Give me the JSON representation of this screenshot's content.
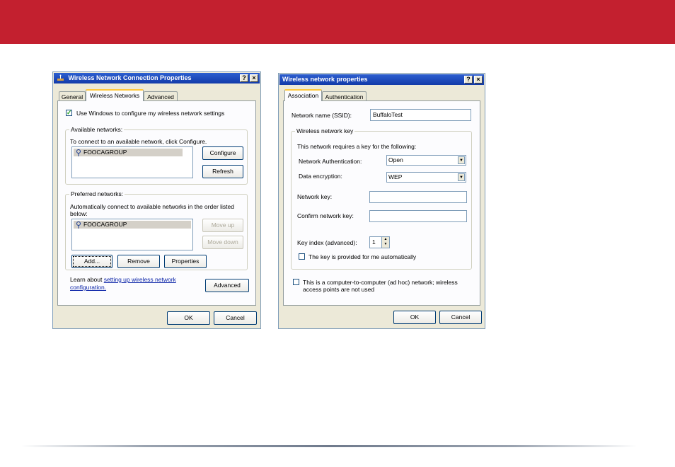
{
  "colors": {
    "banner": "#c3202f",
    "titlebar": "#2d5fd0"
  },
  "left_dialog": {
    "title": "Wireless Network Connection Properties",
    "help_button": "?",
    "close_button": "×",
    "tabs": [
      "General",
      "Wireless Networks",
      "Advanced"
    ],
    "use_windows_checkbox": "Use Windows to configure my wireless network settings",
    "available_networks": {
      "title": "Available networks:",
      "hint": "To connect to an available network, click Configure.",
      "items": [
        "FOOCAGROUP"
      ],
      "configure_button": "Configure",
      "refresh_button": "Refresh"
    },
    "preferred_networks": {
      "title": "Preferred networks:",
      "hint_line1": "Automatically connect to available networks in the order listed",
      "hint_line2": "below:",
      "items": [
        "FOOCAGROUP"
      ],
      "move_up_button": "Move up",
      "move_down_button": "Move down",
      "add_button": "Add...",
      "remove_button": "Remove",
      "properties_button": "Properties"
    },
    "learn_about_text": "Learn about",
    "learn_link_line1": "setting up wireless network",
    "learn_link_line2": "configuration.",
    "advanced_button": "Advanced",
    "ok_button": "OK",
    "cancel_button": "Cancel"
  },
  "right_dialog": {
    "title": "Wireless network properties",
    "help_button": "?",
    "close_button": "×",
    "tabs": [
      "Association",
      "Authentication"
    ],
    "ssid_label": "Network name (SSID):",
    "ssid_value": "BuffaloTest",
    "key_group_title": "Wireless network key",
    "key_hint": "This network requires a key for the following:",
    "auth_label": "Network Authentication:",
    "auth_value": "Open",
    "encryption_label": "Data encryption:",
    "encryption_value": "WEP",
    "network_key_label": "Network key:",
    "confirm_key_label": "Confirm network key:",
    "key_index_label": "Key index (advanced):",
    "key_index_value": "1",
    "auto_key_checkbox": "The key is provided for me automatically",
    "adhoc_line1": "This is a computer-to-computer (ad hoc) network; wireless",
    "adhoc_line2": "access points are not used",
    "ok_button": "OK",
    "cancel_button": "Cancel"
  }
}
